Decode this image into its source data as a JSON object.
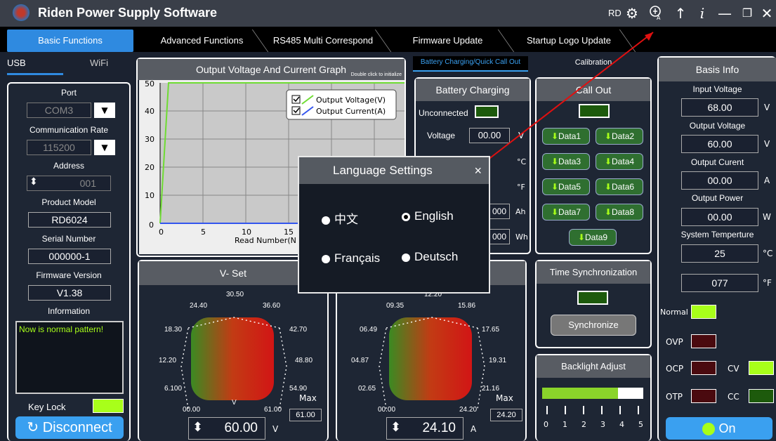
{
  "titlebar": {
    "app_title": "Riden Power Supply Software",
    "rd_label": "RD",
    "icons": [
      "settings-icon",
      "language-icon",
      "upload-icon",
      "info-icon",
      "minimize-icon",
      "restore-icon",
      "close-icon"
    ]
  },
  "tabs": [
    "Basic Functions",
    "Advanced Functions",
    "RS485 Multi Correspond",
    "Firmware Update",
    "Startup Logo Update"
  ],
  "conn_tabs": [
    "USB",
    "WiFi"
  ],
  "left": {
    "port_label": "Port",
    "port_value": "COM3",
    "rate_label": "Communication Rate",
    "rate_value": "115200",
    "address_label": "Address",
    "address_value": "001",
    "model_label": "Product Model",
    "model_value": "RD6024",
    "serial_label": "Serial Number",
    "serial_value": "000000-1",
    "fw_label": "Firmware Version",
    "fw_value": "V1.38",
    "info_label": "Information",
    "info_text": "Now is normal pattern!",
    "keylock_label": "Key Lock",
    "disconnect_label": "Disconnect"
  },
  "graph": {
    "title": "Output Voltage And Current Graph",
    "hint": "Double click to initialize",
    "legend": [
      "Output Voltage(V)",
      "Output Current(A)"
    ],
    "y_ticks": [
      "50",
      "40",
      "30",
      "20",
      "10",
      "0"
    ],
    "x_ticks": [
      "0",
      "5",
      "10",
      "15"
    ],
    "xlabel": "Read Number(N"
  },
  "sub_tabs": [
    "Battery Charging/Quick Call Out",
    "Calibration"
  ],
  "battery": {
    "title": "Battery Charging",
    "status": "Unconnected",
    "voltage_label": "Voltage",
    "voltage_value": "00.00",
    "voltage_unit": "V",
    "c_unit": "°C",
    "f_unit": "°F",
    "ah_value": "000",
    "ah_unit": "Ah",
    "wh_value": "000",
    "wh_unit": "Wh"
  },
  "callout": {
    "title": "Call Out",
    "buttons": [
      "Data1",
      "Data2",
      "Data3",
      "Data4",
      "Data5",
      "Data6",
      "Data7",
      "Data8",
      "Data9"
    ]
  },
  "time_sync": {
    "title": "Time Synchronization",
    "button": "Synchronize"
  },
  "backlight": {
    "title": "Backlight Adjust",
    "ticks": [
      "0",
      "1",
      "2",
      "3",
      "4",
      "5"
    ],
    "level_fraction": 0.75
  },
  "vset": {
    "title": "V- Set",
    "dial_labels": [
      "30.50",
      "24.40",
      "36.60",
      "18.30",
      "42.70",
      "12.20",
      "48.80",
      "6.100",
      "54.90",
      "00.00",
      "61.00"
    ],
    "unit_letter": "V",
    "max_label": "Max",
    "max_value": "61.00",
    "value": "60.00",
    "unit": "V"
  },
  "iset": {
    "dial_labels": [
      "12.20",
      "09.35",
      "15.86",
      "06.49",
      "17.65",
      "04.87",
      "19.31",
      "02.65",
      "21.16",
      "00.00",
      "24.20"
    ],
    "max_label": "Max",
    "max_value": "24.20",
    "value": "24.10",
    "unit": "A"
  },
  "basis": {
    "title": "Basis Info",
    "input_voltage_label": "Input Voltage",
    "input_voltage": "68.00",
    "input_voltage_unit": "V",
    "output_voltage_label": "Output Voltage",
    "output_voltage": "60.00",
    "output_voltage_unit": "V",
    "output_current_label": "Output Curent",
    "output_current": "00.00",
    "output_current_unit": "A",
    "output_power_label": "Output Power",
    "output_power": "00.00",
    "output_power_unit": "W",
    "temp_label": "System Temperture",
    "temp_c": "25",
    "temp_c_unit": "°C",
    "temp_f": "077",
    "temp_f_unit": "°F",
    "normal_label": "Normal",
    "ovp_label": "OVP",
    "ocp_label": "OCP",
    "otp_label": "OTP",
    "cv_label": "CV",
    "cc_label": "CC",
    "on_label": "On"
  },
  "modal": {
    "title": "Language Settings",
    "close": "×",
    "options": [
      "中文",
      "English",
      "Français",
      "Deutsch"
    ],
    "selected": "English"
  },
  "colors": {
    "accent": "#2f8ae0",
    "led_green": "#a8ff1a",
    "led_dark_green": "#1d5a0c",
    "led_red": "#4a0a0f"
  }
}
